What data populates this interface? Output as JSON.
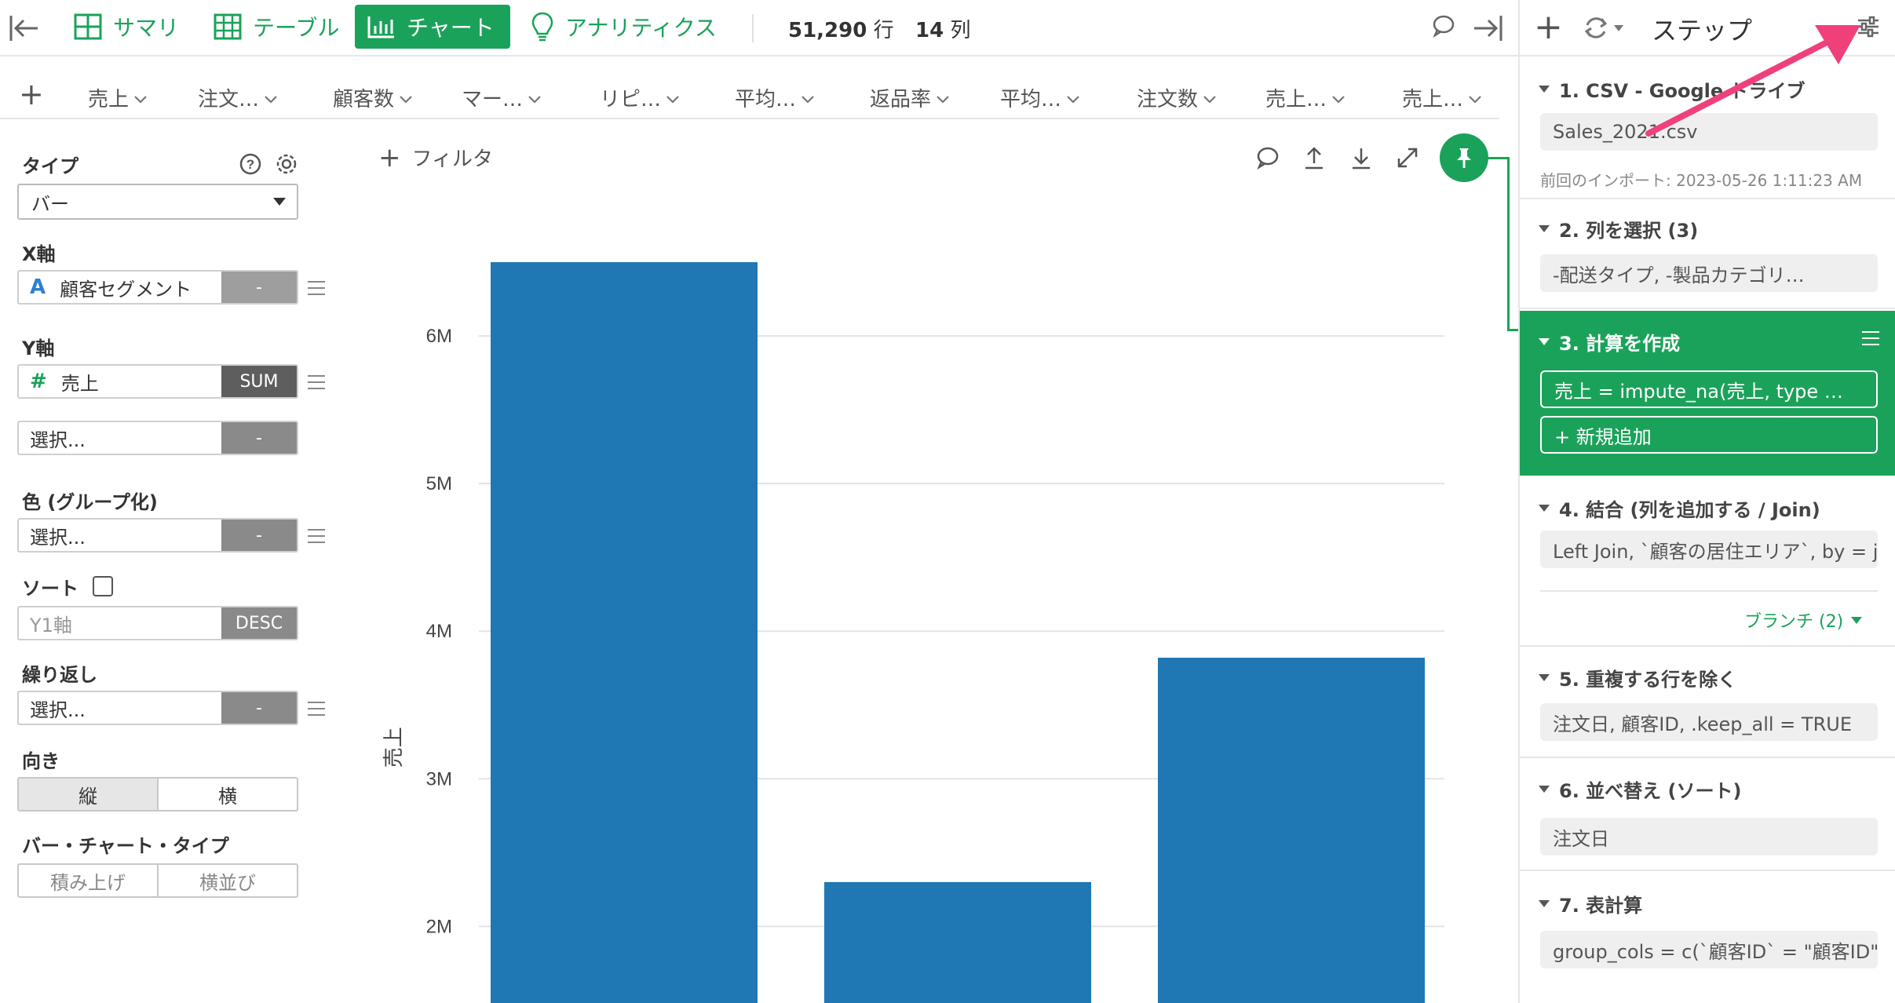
{
  "toolbar": {
    "tabs": [
      {
        "label": "サマリ",
        "icon": "summary-grid-icon"
      },
      {
        "label": "テーブル",
        "icon": "table-icon"
      },
      {
        "label": "チャート",
        "icon": "bar-chart-icon"
      },
      {
        "label": "アナリティクス",
        "icon": "lightbulb-icon"
      }
    ],
    "active_tab": "チャート",
    "row_count": "51,290",
    "row_unit": "行",
    "col_count": "14",
    "col_unit": "列"
  },
  "columns": [
    "売上",
    "注文…",
    "顧客数",
    "マー…",
    "リピ…",
    "平均…",
    "返品率",
    "平均…",
    "注文数",
    "売上…",
    "売上…"
  ],
  "config": {
    "type_label": "タイプ",
    "type_value": "バー",
    "x_label": "X軸",
    "x_value": "顧客セグメント",
    "x_type_icon": "A",
    "x_agg": "-",
    "y_label": "Y軸",
    "y_value": "売上",
    "y_type_icon": "#",
    "y_agg": "SUM",
    "y2_value": "選択...",
    "y2_agg": "-",
    "color_label": "色 (グループ化)",
    "color_value": "選択...",
    "color_agg": "-",
    "sort_label": "ソート",
    "sort_placeholder": "Y1軸",
    "sort_order": "DESC",
    "repeat_label": "繰り返し",
    "repeat_value": "選択...",
    "repeat_agg": "-",
    "orientation_label": "向き",
    "orientation_options": [
      "縦",
      "横"
    ],
    "orientation_selected": "縦",
    "bar_type_label": "バー・チャート・タイプ",
    "bar_type_options": [
      "積み上げ",
      "横並び"
    ]
  },
  "chart": {
    "filter_label": "フィルタ"
  },
  "chart_data": {
    "type": "bar",
    "ylabel": "売上",
    "xlabel": "",
    "y_ticks": [
      "2M",
      "3M",
      "4M",
      "5M",
      "6M"
    ],
    "y_tick_values": [
      2000000,
      3000000,
      4000000,
      5000000,
      6000000
    ],
    "categories": [
      "",
      "",
      ""
    ],
    "values": [
      6500000,
      2300000,
      3820000
    ],
    "ylim": [
      1470000,
      7000000
    ],
    "bar_color": "#1f77b4",
    "grid": true
  },
  "steps_panel": {
    "title": "ステップ",
    "steps": [
      {
        "title": "1. CSV - Google ドライブ",
        "box": "Sales_2021.csv",
        "note": "前回のインポート: 2023-05-26 1:11:23 AM"
      },
      {
        "title": "2. 列を選択 (3)",
        "box": "-配送タイプ, -製品カテゴリ…"
      },
      {
        "title": "3. 計算を作成",
        "box": "売上 = impute_na(売上, type …",
        "add": "+ 新規追加"
      },
      {
        "title": "4. 結合 (列を追加する / Join)",
        "box": "Left Join, `顧客の居住エリア`, by = j…",
        "branch": "ブランチ (2)"
      },
      {
        "title": "5. 重複する行を除く",
        "box": "注文日, 顧客ID, .keep_all = TRUE"
      },
      {
        "title": "6. 並べ替え (ソート)",
        "box": "注文日"
      },
      {
        "title": "7. 表計算",
        "box": "group_cols = c(`顧客ID` = \"顧客ID\"),…"
      }
    ]
  },
  "colors": {
    "accent": "#1ba25a",
    "bar": "#1f77b4",
    "annotation_arrow": "#f0407a"
  }
}
